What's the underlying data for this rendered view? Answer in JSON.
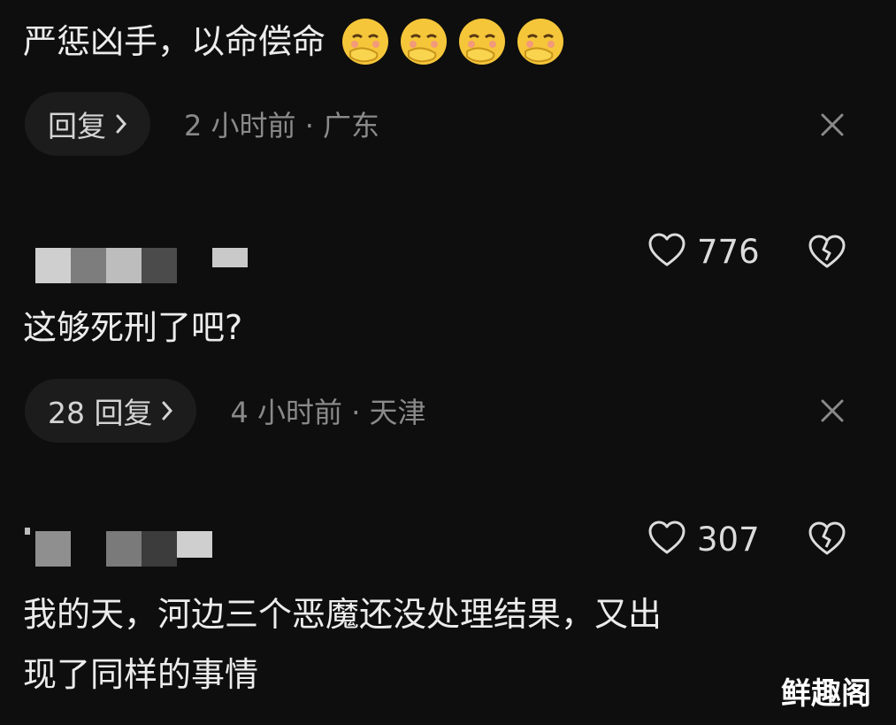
{
  "comments": [
    {
      "text": "严惩凶手，以命偿命",
      "reply_label": "回复",
      "meta": "2 小时前 · 广东"
    },
    {
      "likes": "776",
      "text": "这够死刑了吧?",
      "reply_label": "28 回复",
      "meta": "4 小时前 · 天津"
    },
    {
      "likes": "307",
      "text_line1": "我的天，河边三个恶魔还没处理结果，又出",
      "text_line2": "现了同样的事情"
    }
  ],
  "emoji_icon": "smiling-face-with-hand-over-mouth",
  "watermark": "鲜趣阁",
  "colors": {
    "background": "#0e0e0e",
    "pill": "#1c1c1c",
    "meta_text": "#8a8a8a",
    "emoji_yellow": "#f6c63a"
  }
}
